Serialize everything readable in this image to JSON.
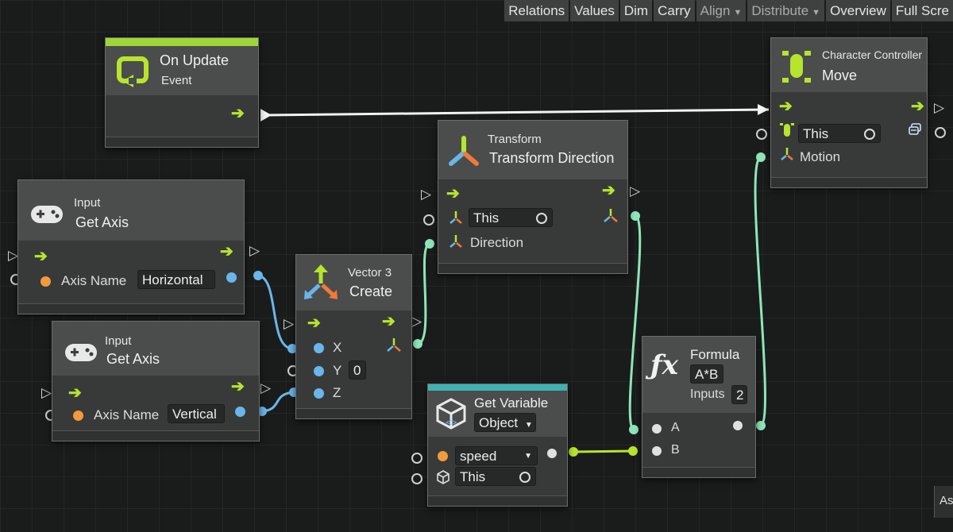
{
  "toolbar": {
    "relations": "Relations",
    "values": "Values",
    "dim": "Dim",
    "carry": "Carry",
    "align": "Align",
    "distribute": "Distribute",
    "overview": "Overview",
    "full_screen": "Full Scre"
  },
  "nodes": {
    "on_update": {
      "title": "On Update",
      "category": "Event"
    },
    "get_axis_1": {
      "category": "Input",
      "title": "Get Axis",
      "port_label": "Axis Name",
      "value": "Horizontal"
    },
    "get_axis_2": {
      "category": "Input",
      "title": "Get Axis",
      "port_label": "Axis Name",
      "value": "Vertical"
    },
    "vector3": {
      "category": "Vector 3",
      "title": "Create",
      "x_label": "X",
      "y_label": "Y",
      "y_value": "0",
      "z_label": "Z"
    },
    "transform": {
      "category": "Transform",
      "title": "Transform Direction",
      "this_value": "This",
      "direction_label": "Direction"
    },
    "get_variable": {
      "title": "Get Variable",
      "kind": "Object",
      "name_value": "speed",
      "target_value": "This"
    },
    "formula": {
      "title": "Formula",
      "expression": "A*B",
      "inputs_label": "Inputs",
      "inputs_value": "2",
      "a_label": "A",
      "b_label": "B"
    },
    "char_ctrl": {
      "category": "Character Controller",
      "title": "Move",
      "this_value": "This",
      "motion_label": "Motion"
    }
  },
  "edge_label": "As",
  "colors": {
    "flow_arrow": "#b8e42c",
    "event_header": "#9ed63a",
    "variable_header": "#3fb3b0",
    "wire_blue": "#6ab6ea",
    "wire_green": "#8ee6b8",
    "wire_lime": "#b8e42c"
  },
  "icons": [
    "loop-event-icon",
    "gamepad-icon",
    "vector3-axes-icon",
    "transform-axes-icon",
    "cube-icon",
    "fx-icon",
    "character-controller-icon",
    "this-target-icon",
    "dropdown-caret-icon",
    "chevron-flow-icon"
  ]
}
